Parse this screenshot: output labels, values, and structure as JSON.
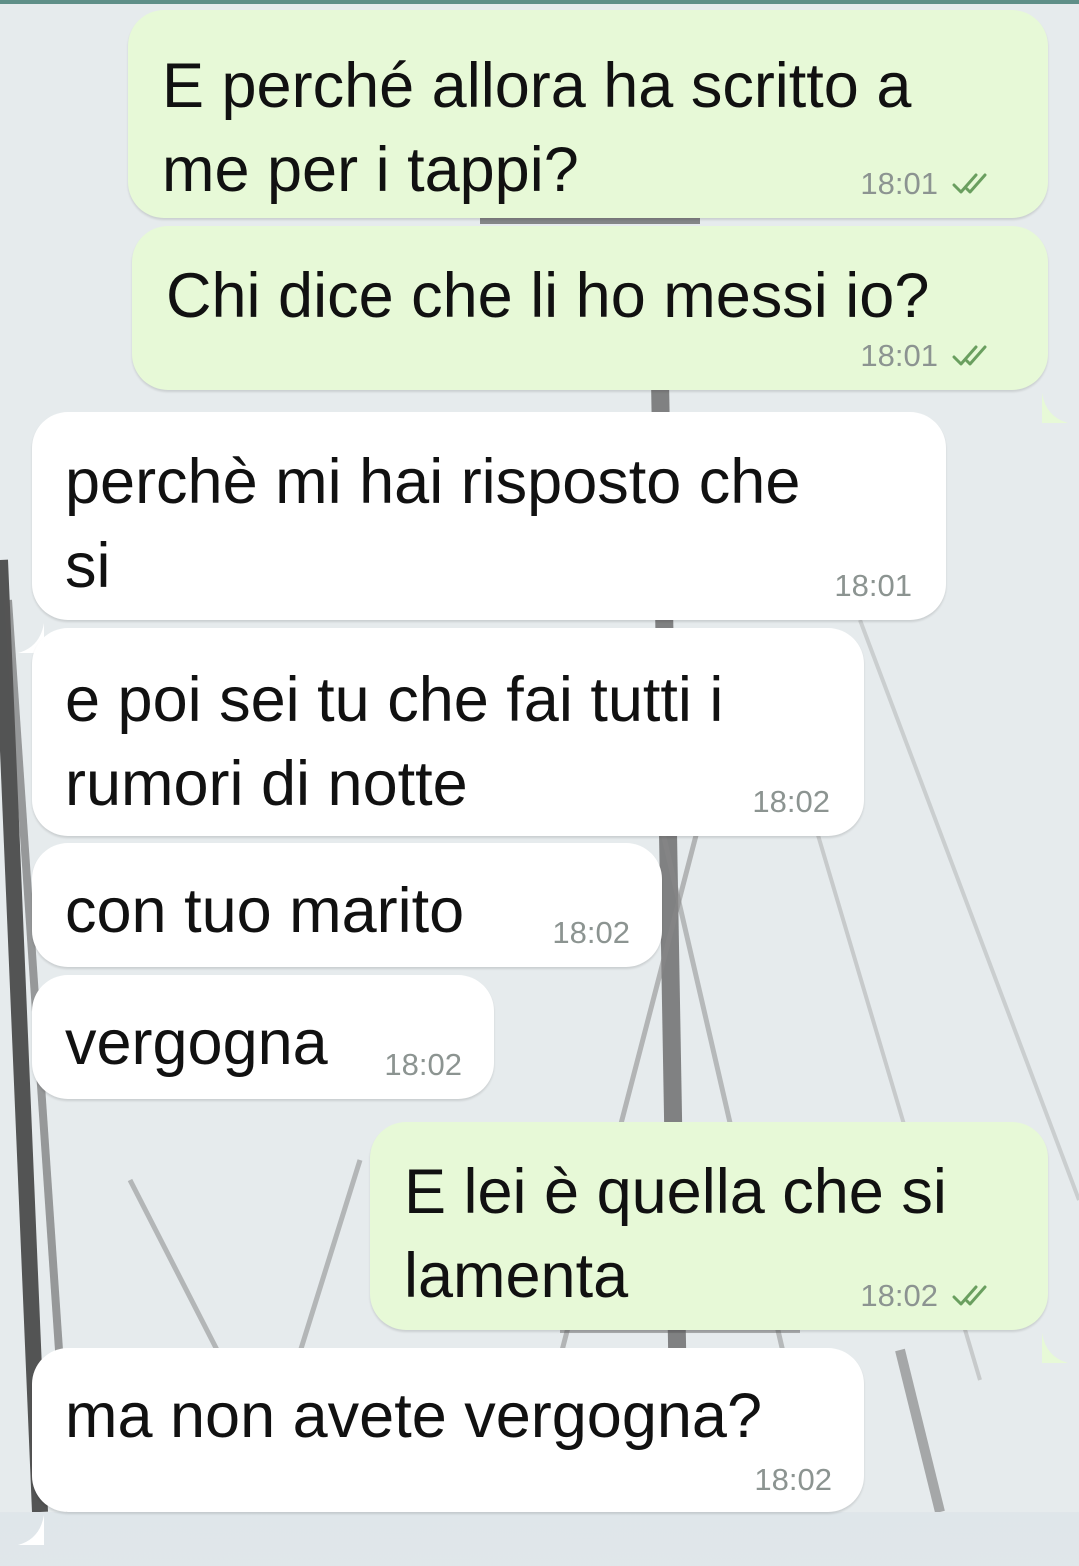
{
  "chat": {
    "messages": [
      {
        "direction": "outgoing",
        "text": "E perché allora ha scritto a\nme per i tappi?",
        "time": "18:01",
        "read": true
      },
      {
        "direction": "outgoing",
        "text": "Chi dice che li ho messi io?",
        "time": "18:01",
        "read": true
      },
      {
        "direction": "incoming",
        "text": "perchè mi hai risposto che\nsi",
        "time": "18:01"
      },
      {
        "direction": "incoming",
        "text": "e poi sei tu che fai tutti i\nrumori di notte",
        "time": "18:02"
      },
      {
        "direction": "incoming",
        "text": "con tuo marito",
        "time": "18:02"
      },
      {
        "direction": "incoming",
        "text": "vergogna",
        "time": "18:02"
      },
      {
        "direction": "outgoing",
        "text": "E lei è quella che si\nlamenta",
        "time": "18:02",
        "read": true
      },
      {
        "direction": "incoming",
        "text": "ma non avete vergogna?",
        "time": "18:02"
      }
    ]
  },
  "icons": {
    "read_receipt": "double-check-icon"
  },
  "colors": {
    "outgoing_bubble": "#e7f9d7",
    "incoming_bubble": "#ffffff",
    "timestamp": "#8c9491",
    "read_tick": "#6a9f5f"
  }
}
